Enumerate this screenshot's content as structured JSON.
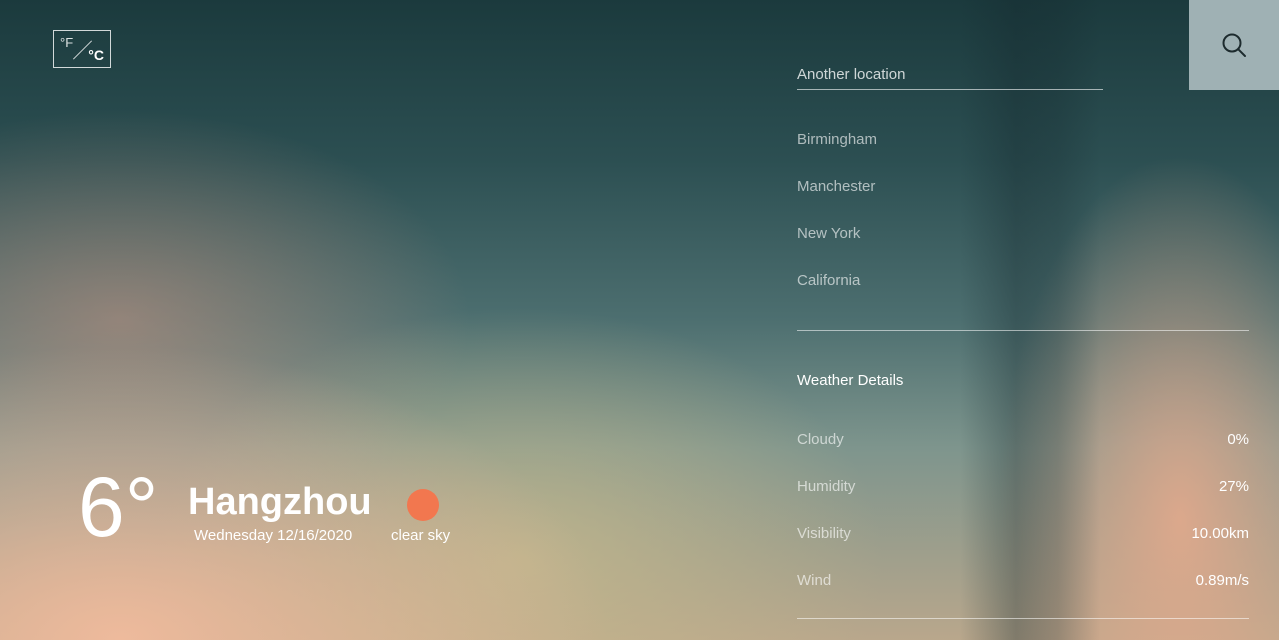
{
  "unit_toggle": {
    "fahrenheit": "°F",
    "celsius": "°C"
  },
  "current": {
    "temperature": "6°",
    "city": "Hangzhou",
    "date": "Wednesday 12/16/2020",
    "condition": "clear sky",
    "condition_icon": "sun-icon",
    "icon_color": "#f2774f"
  },
  "search": {
    "label": "Another location"
  },
  "locations": [
    "Birmingham",
    "Manchester",
    "New York",
    "California"
  ],
  "details": {
    "title": "Weather Details",
    "items": [
      {
        "label": "Cloudy",
        "value": "0%"
      },
      {
        "label": "Humidity",
        "value": "27%"
      },
      {
        "label": "Visibility",
        "value": "10.00km"
      },
      {
        "label": "Wind",
        "value": "0.89m/s"
      }
    ]
  },
  "search_button": {
    "icon": "search-icon",
    "color": "#9fb1b4"
  }
}
